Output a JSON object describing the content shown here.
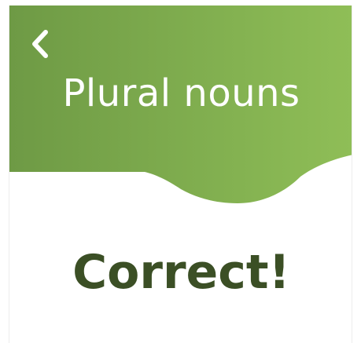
{
  "header": {
    "title": "Plural nouns",
    "back_icon": "chevron-left-icon",
    "gradient_start": "#6e9a45",
    "gradient_end": "#8fbe57"
  },
  "feedback": {
    "message": "Correct!",
    "color": "#3b4f25"
  }
}
